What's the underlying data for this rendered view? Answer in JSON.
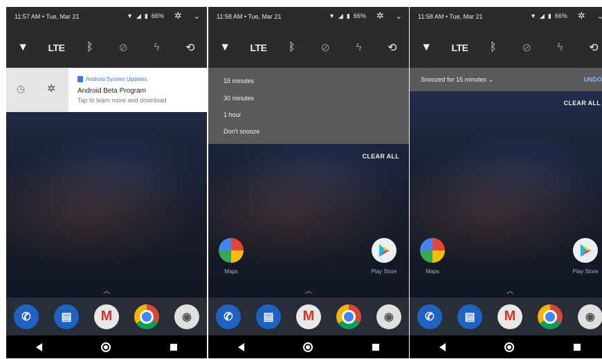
{
  "screens": [
    {
      "status": {
        "time": "11:57 AM • Tue, Mar 21",
        "battery": "66%"
      },
      "notification": {
        "app_name": "Android System Updates",
        "title": "Android Beta Program",
        "body": "Tap to learn more and download"
      }
    },
    {
      "status": {
        "time": "11:58 AM • Tue, Mar 21",
        "battery": "66%"
      },
      "snooze_options": [
        "15 minutes",
        "30 minutes",
        "1 hour",
        "Don't snooze"
      ],
      "clear_all": "CLEAR ALL",
      "home_apps": [
        {
          "label": "Maps"
        },
        {
          "label": "Play Store"
        }
      ]
    },
    {
      "status": {
        "time": "11:58 AM • Tue, Mar 21",
        "battery": "66%"
      },
      "snoozed_text": "Snoozed for 15 minutes",
      "undo": "UNDO",
      "clear_all": "CLEAR ALL",
      "home_apps": [
        {
          "label": "Maps"
        },
        {
          "label": "Play Store"
        }
      ]
    }
  ],
  "quick_settings": {
    "lte_label": "LTE"
  },
  "icons": {
    "wifi": "wifi-icon",
    "lte": "lte-tile",
    "bluetooth": "bluetooth-icon",
    "dnd": "do-not-disturb-off-icon",
    "flashlight": "flashlight-icon",
    "rotate": "auto-rotate-icon",
    "settings": "gear-icon",
    "expand": "chevron-down-icon",
    "clock": "clock-icon"
  },
  "colors": {
    "accent_link": "#3b78e7",
    "undo": "#8ab4f8",
    "panel_dark": "#2b2b2b",
    "menu_gray": "#5a5a5a"
  }
}
